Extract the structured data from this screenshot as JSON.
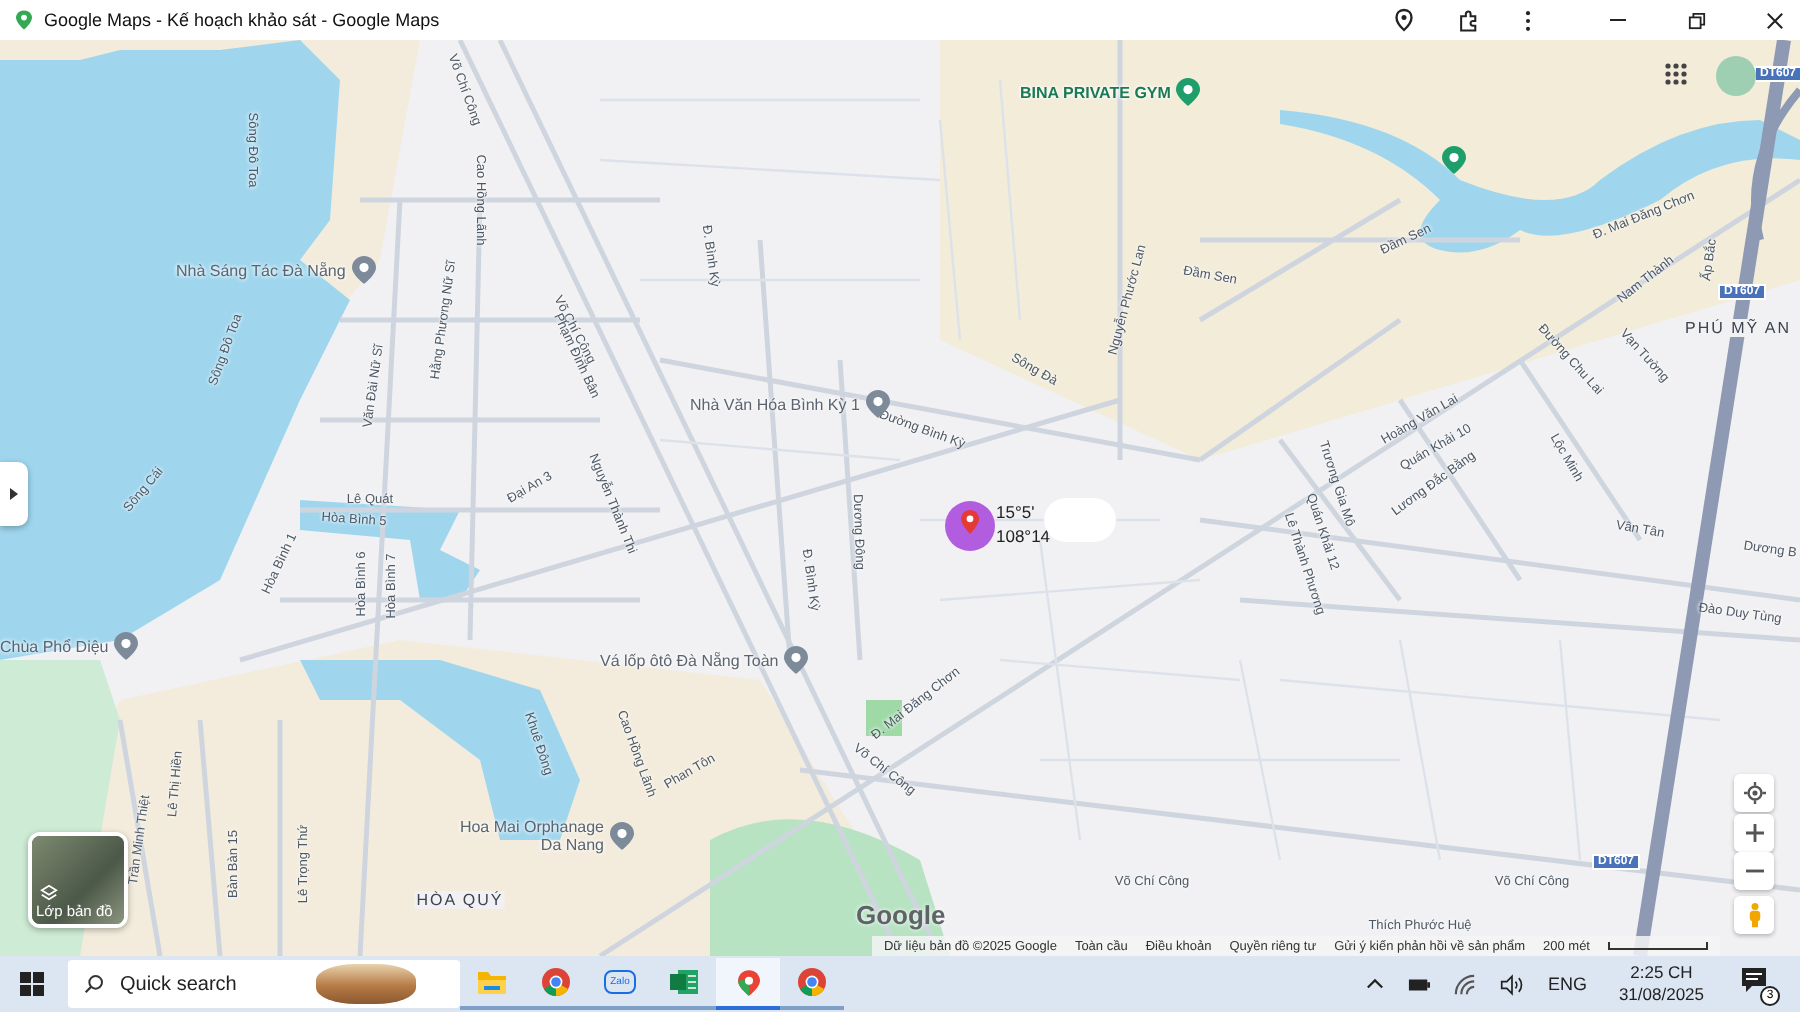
{
  "window": {
    "title": "Google Maps - Kế hoạch khảo sát - Google Maps"
  },
  "map": {
    "places": [
      {
        "name": "BINA PRIVATE GYM",
        "kind": "green"
      },
      {
        "name": "Nhà Sáng Tác Đà Nẵng",
        "kind": "gray"
      },
      {
        "name": "Nhà Văn Hóa Bình Kỳ 1",
        "kind": "gray"
      },
      {
        "name": "Vá lốp ôtô Đà Nẵng Toàn",
        "kind": "gray"
      },
      {
        "name": "Chùa Phổ Diệu",
        "kind": "gray"
      },
      {
        "name": "Hoa Mai Orphanage Da Nang",
        "kind": "gray"
      }
    ],
    "streets": [
      "Võ Chí Công",
      "Võ Chí Công",
      "Võ Chí Công",
      "Võ Chí Công",
      "Võ Chí Công",
      "Sông Đô Toa",
      "Sông Đô Toa",
      "Sông Cái",
      "Cao Hồng Lãnh",
      "Cao Hồng Lãnh",
      "Hằng Phương Nữ Sĩ",
      "Văn Đài Nữ Sĩ",
      "Phạm Đình Bân",
      "Nguyễn Thành Thi",
      "Đại An 3",
      "Lê Quát",
      "Hòa Bình 5",
      "Hòa Bình 1",
      "Hòa Bình 6",
      "Hòa Bình 7",
      "Khuê Đông",
      "Trần Minh Thiệt",
      "Lê Thị Hiền",
      "Bàn Bàn 15",
      "Lê Trọng Thứ",
      "Phan Tôn",
      "Đ. Bình Kỳ",
      "Đ. Bình Kỳ",
      "Đường Bình Kỳ",
      "Dương Đông",
      "Sông Đà",
      "Nguyễn Phước Lan",
      "Đầm Sen",
      "Đầm Sen",
      "Đ. Mai Đăng Chơn",
      "Đ. Mai Đăng Chơn",
      "Nam Thành",
      "Ấp Bắc",
      "Vạn Tường",
      "Đường Chu Lai",
      "Hoàng Văn Lai",
      "Quán Khải 10",
      "Lương Đắc Bằng",
      "Trương Gia Mô",
      "Quán Khải 12",
      "Lê Thành Phương",
      "Lộc Minh",
      "Vân Tân",
      "Dương B",
      "Đào Duy Tùng",
      "Thích Phước Huệ"
    ],
    "areas": [
      "PHÚ MỸ AN",
      "HÒA QUÝ"
    ],
    "road_shields": [
      "DT607",
      "DT607",
      "DT607"
    ],
    "marker": {
      "lat": "15°5'",
      "lng": "108°14"
    },
    "layers_button": {
      "label": "Lớp bản đồ"
    },
    "logo": "Google",
    "footer": [
      "Dữ liệu bản đồ ©2025 Google",
      "Toàn cầu",
      "Điều khoản",
      "Quyền riêng tư",
      "Gửi ý kiến phản hồi về sản phẩm"
    ],
    "scale": "200 mét"
  },
  "taskbar": {
    "search": {
      "placeholder": "Quick search"
    },
    "apps": [
      {
        "kind": "folder",
        "selected": false
      },
      {
        "kind": "chrome",
        "selected": false
      },
      {
        "kind": "zalo",
        "label": "Zalo",
        "selected": false
      },
      {
        "kind": "excel",
        "selected": false
      },
      {
        "kind": "maps",
        "selected": true
      },
      {
        "kind": "chrome",
        "selected": false
      }
    ],
    "language": "ENG",
    "time": "2:25 CH",
    "date": "31/08/2025",
    "notifications": "3"
  }
}
